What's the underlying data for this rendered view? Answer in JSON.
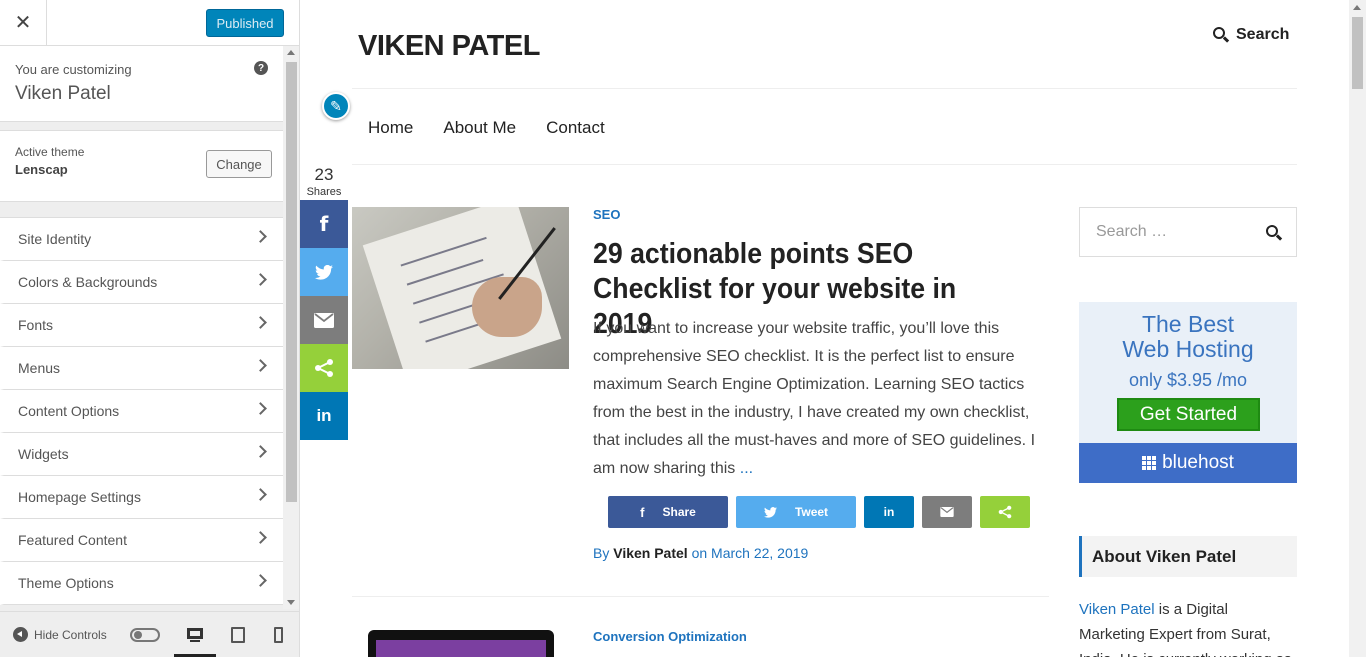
{
  "customizer": {
    "close_label": "✕",
    "publish_label": "Published",
    "customizing_label": "You are customizing",
    "site_name": "Viken Patel",
    "help_label": "?",
    "active_theme_label": "Active theme",
    "active_theme_name": "Lenscap",
    "change_label": "Change",
    "menu_items": [
      {
        "label": "Site Identity"
      },
      {
        "label": "Colors & Backgrounds"
      },
      {
        "label": "Fonts"
      },
      {
        "label": "Menus"
      },
      {
        "label": "Content Options"
      },
      {
        "label": "Widgets"
      },
      {
        "label": "Homepage Settings"
      },
      {
        "label": "Featured Content"
      },
      {
        "label": "Theme Options"
      }
    ],
    "hide_controls_label": "Hide Controls",
    "active_device": "desktop"
  },
  "site": {
    "title": "VIKEN PATEL",
    "header_search_label": "Search",
    "nav": [
      "Home",
      "About Me",
      "Contact"
    ],
    "share_count": "23",
    "share_count_label": "Shares",
    "floating_share_icons": [
      "facebook-icon",
      "twitter-icon",
      "email-icon",
      "share-icon",
      "linkedin-icon"
    ]
  },
  "post": {
    "category": "SEO",
    "title": "29 actionable points SEO Checklist for your website in 2019",
    "excerpt": "If you want to increase your website traffic, you’ll love this comprehensive SEO checklist. It is the perfect list to ensure maximum Search Engine Optimization. Learning SEO tactics from the best in the industry, I have created my own checklist, that includes all the must-haves and more of SEO guidelines. I am now sharing this",
    "more": "...",
    "share_facebook": "Share",
    "share_twitter": "Tweet",
    "share_linkedin": "in",
    "by": "By",
    "author": "Viken Patel",
    "date_prefix": "on",
    "date": "March 22, 2019"
  },
  "post2": {
    "category": "Conversion Optimization"
  },
  "sidebar_widgets": {
    "search_placeholder": "Search …",
    "ad_line1": "The Best",
    "ad_line2": "Web Hosting",
    "ad_price": "only  $3.95 /mo",
    "ad_cta": "Get Started",
    "ad_brand": "bluehost",
    "about_title": "About Viken Patel",
    "about_link": "Viken Patel",
    "about_text": " is a Digital Marketing Expert from Surat, India. He is currently working as"
  },
  "colors": {
    "wp_blue": "#0085ba",
    "link": "#1e73be",
    "facebook": "#3b5998",
    "twitter": "#55acee",
    "email": "#7d7d7d",
    "sharethis": "#95d03a",
    "linkedin": "#0077b5"
  }
}
